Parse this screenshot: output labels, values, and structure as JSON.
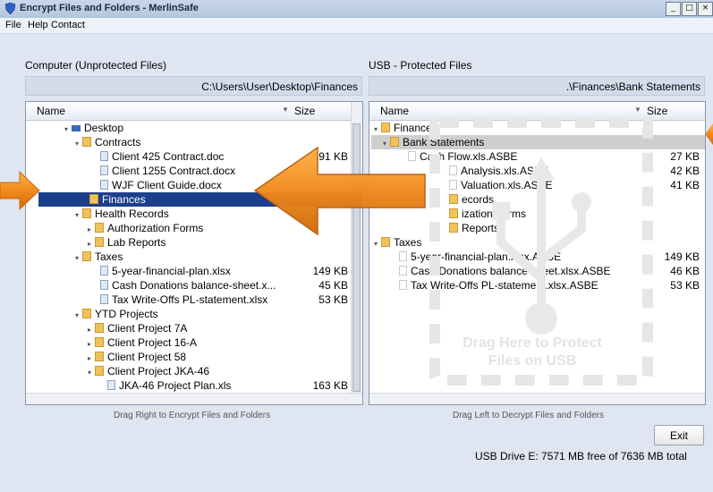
{
  "window": {
    "title": "Encrypt Files and Folders - MerlinSafe",
    "min": "_",
    "max": "□",
    "close": "×"
  },
  "menu": [
    "File",
    "Help",
    "Contact"
  ],
  "left": {
    "title": "Computer (Unprotected Files)",
    "path": "C:\\Users\\User\\Desktop\\Finances",
    "col_name": "Name",
    "col_size": "Size",
    "rows": [
      {
        "label": "Desktop",
        "size": ""
      },
      {
        "label": "Contracts",
        "size": ""
      },
      {
        "label": "Client 425 Contract.doc",
        "size": "191 KB"
      },
      {
        "label": "Client 1255 Contract.docx",
        "size": ""
      },
      {
        "label": "WJF Client Guide.docx",
        "size": ""
      },
      {
        "label": "Finances",
        "size": ""
      },
      {
        "label": "Health Records",
        "size": ""
      },
      {
        "label": "Authorization Forms",
        "size": ""
      },
      {
        "label": "Lab Reports",
        "size": ""
      },
      {
        "label": "Taxes",
        "size": ""
      },
      {
        "label": "5-year-financial-plan.xlsx",
        "size": "149 KB"
      },
      {
        "label": "Cash Donations balance-sheet.x...",
        "size": "45 KB"
      },
      {
        "label": "Tax Write-Offs PL-statement.xlsx",
        "size": "53 KB"
      },
      {
        "label": "YTD Projects",
        "size": ""
      },
      {
        "label": "Client Project 7A",
        "size": ""
      },
      {
        "label": "Client Project 16-A",
        "size": ""
      },
      {
        "label": "Client Project 58",
        "size": ""
      },
      {
        "label": "Client Project JKA-46",
        "size": ""
      },
      {
        "label": "JKA-46 Project Plan.xls",
        "size": "163 KB"
      }
    ],
    "hint": "Drag Right to Encrypt Files and Folders"
  },
  "right": {
    "title": "USB - Protected Files",
    "path": ".\\Finances\\Bank Statements",
    "col_name": "Name",
    "col_size": "Size",
    "rows": [
      {
        "label": "Finances",
        "size": ""
      },
      {
        "label": "Bank Statements",
        "size": ""
      },
      {
        "label": "Cash Flow.xls.ASBE",
        "size": "27 KB"
      },
      {
        "label": "Analysis.xls.ASBE",
        "size": "42 KB"
      },
      {
        "label": "Valuation.xls.ASBE",
        "size": "41 KB"
      },
      {
        "label": "ecords",
        "size": ""
      },
      {
        "label": "ization Forms",
        "size": ""
      },
      {
        "label": "Reports",
        "size": ""
      },
      {
        "label": "Taxes",
        "size": ""
      },
      {
        "label": "5-year-financial-plan.xlsx.ASBE",
        "size": "149 KB"
      },
      {
        "label": "Cash Donations balance-sheet.xlsx.ASBE",
        "size": "46 KB"
      },
      {
        "label": "Tax Write-Offs PL-statement.xlsx.ASBE",
        "size": "53 KB"
      }
    ],
    "drop_text_1": "Drag Here to Protect",
    "drop_text_2": "Files on USB",
    "hint": "Drag Left to Decrypt Files and Folders"
  },
  "exit_label": "Exit",
  "status": "USB Drive E: 7571 MB free of 7636 MB total",
  "colors": {
    "selection": "#1c3f8a",
    "arrow": "#f18a1f",
    "folder": "#f2c25a"
  }
}
